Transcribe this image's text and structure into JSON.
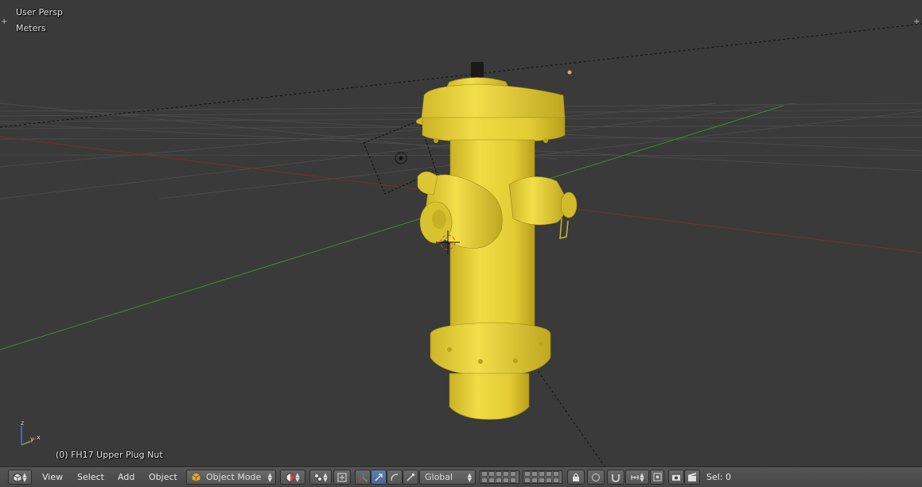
{
  "viewport": {
    "view_name": "User Persp",
    "units": "Meters",
    "object_info": "(0) FH17 Upper Plug Nut"
  },
  "header": {
    "menu": {
      "view": "View",
      "select": "Select",
      "add": "Add",
      "object": "Object"
    },
    "mode": "Object Mode",
    "orientation": "Global",
    "selection": "Sel: 0"
  },
  "colors": {
    "background": "#3a3a3a",
    "grid": "#4a4a4a",
    "x_axis": "#8b2f2f",
    "y_axis": "#3f8f2f",
    "hydrant": "#e8d235",
    "header": "#4f4f4f"
  },
  "icons": {
    "editor_type": "cube-icon",
    "mode": "object-mode-cube-icon",
    "shading": "solid-sphere-icon",
    "pivot": "pivot-icon",
    "manipulator": "manipulator-axes-icon",
    "translate": "translate-arrow-icon",
    "rotate": "rotate-arc-icon",
    "scale": "scale-arrow-icon",
    "layers": "layer-grid-icon",
    "lock": "lock-layer-icon",
    "proportional": "proportional-edit-icon",
    "snap": "magnet-icon",
    "render": "camera-render-icon",
    "animation": "clapper-render-icon"
  }
}
